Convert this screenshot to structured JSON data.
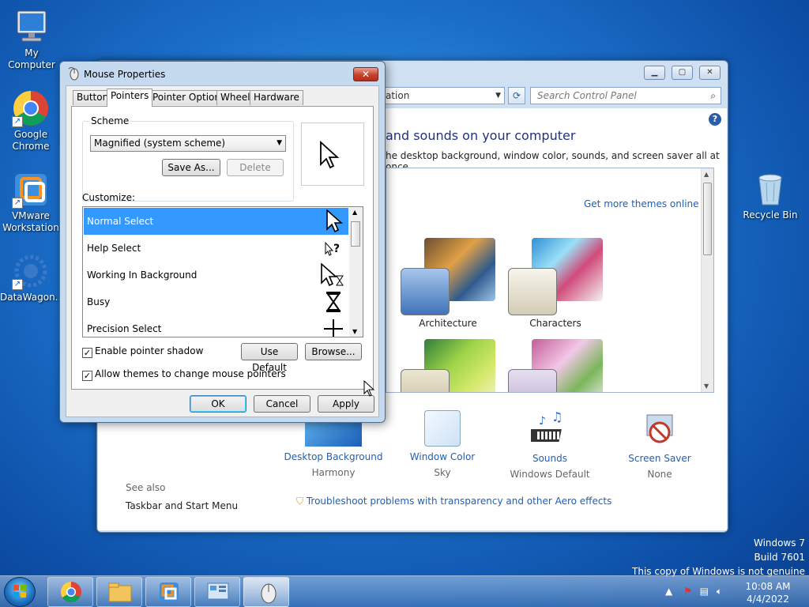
{
  "desktop": {
    "icons": [
      {
        "label": "My Computer"
      },
      {
        "label": "Google Chrome"
      },
      {
        "label": "VMware Workstation"
      },
      {
        "label": "DataWagon..."
      },
      {
        "label": "Recycle Bin"
      }
    ]
  },
  "control_panel": {
    "address_text": "ation",
    "search_placeholder": "Search Control Panel",
    "heading": "and sounds on your computer",
    "subheading": "he desktop background, window color, sounds, and screen saver all at once.",
    "get_more_themes": "Get more themes online",
    "themes": [
      {
        "name": "Architecture"
      },
      {
        "name": "Characters"
      }
    ],
    "bottom_items": [
      {
        "title": "Desktop Background",
        "value": "Harmony"
      },
      {
        "title": "Window Color",
        "value": "Sky"
      },
      {
        "title": "Sounds",
        "value": "Windows Default"
      },
      {
        "title": "Screen Saver",
        "value": "None"
      }
    ],
    "see_also": "See also",
    "taskbar_link": "Taskbar and Start Menu",
    "troubleshoot_link": "Troubleshoot problems with transparency and other Aero effects"
  },
  "mouse_properties": {
    "title": "Mouse Properties",
    "close_label": "✕",
    "tabs": [
      {
        "label": "Buttons"
      },
      {
        "label": "Pointers",
        "active": true
      },
      {
        "label": "Pointer Options"
      },
      {
        "label": "Wheel"
      },
      {
        "label": "Hardware"
      }
    ],
    "scheme_label": "Scheme",
    "scheme_value": "Magnified (system scheme)",
    "save_as_label": "Save As...",
    "delete_label": "Delete",
    "customize_label": "Customize:",
    "cursor_rows": [
      {
        "label": "Normal Select",
        "selected": true
      },
      {
        "label": "Help Select"
      },
      {
        "label": "Working In Background"
      },
      {
        "label": "Busy"
      },
      {
        "label": "Precision Select"
      }
    ],
    "enable_shadow_label": "Enable pointer shadow",
    "enable_shadow_checked": true,
    "allow_themes_label": "Allow themes to change mouse pointers",
    "allow_themes_checked": true,
    "use_default_label": "Use Default",
    "browse_label": "Browse...",
    "ok_label": "OK",
    "cancel_label": "Cancel",
    "apply_label": "Apply"
  },
  "watermark": {
    "line1": "Windows 7",
    "line2": "Build 7601",
    "line3": "This copy of Windows is not genuine"
  },
  "clock": {
    "time": "10:08 AM",
    "date": "4/4/2022"
  }
}
